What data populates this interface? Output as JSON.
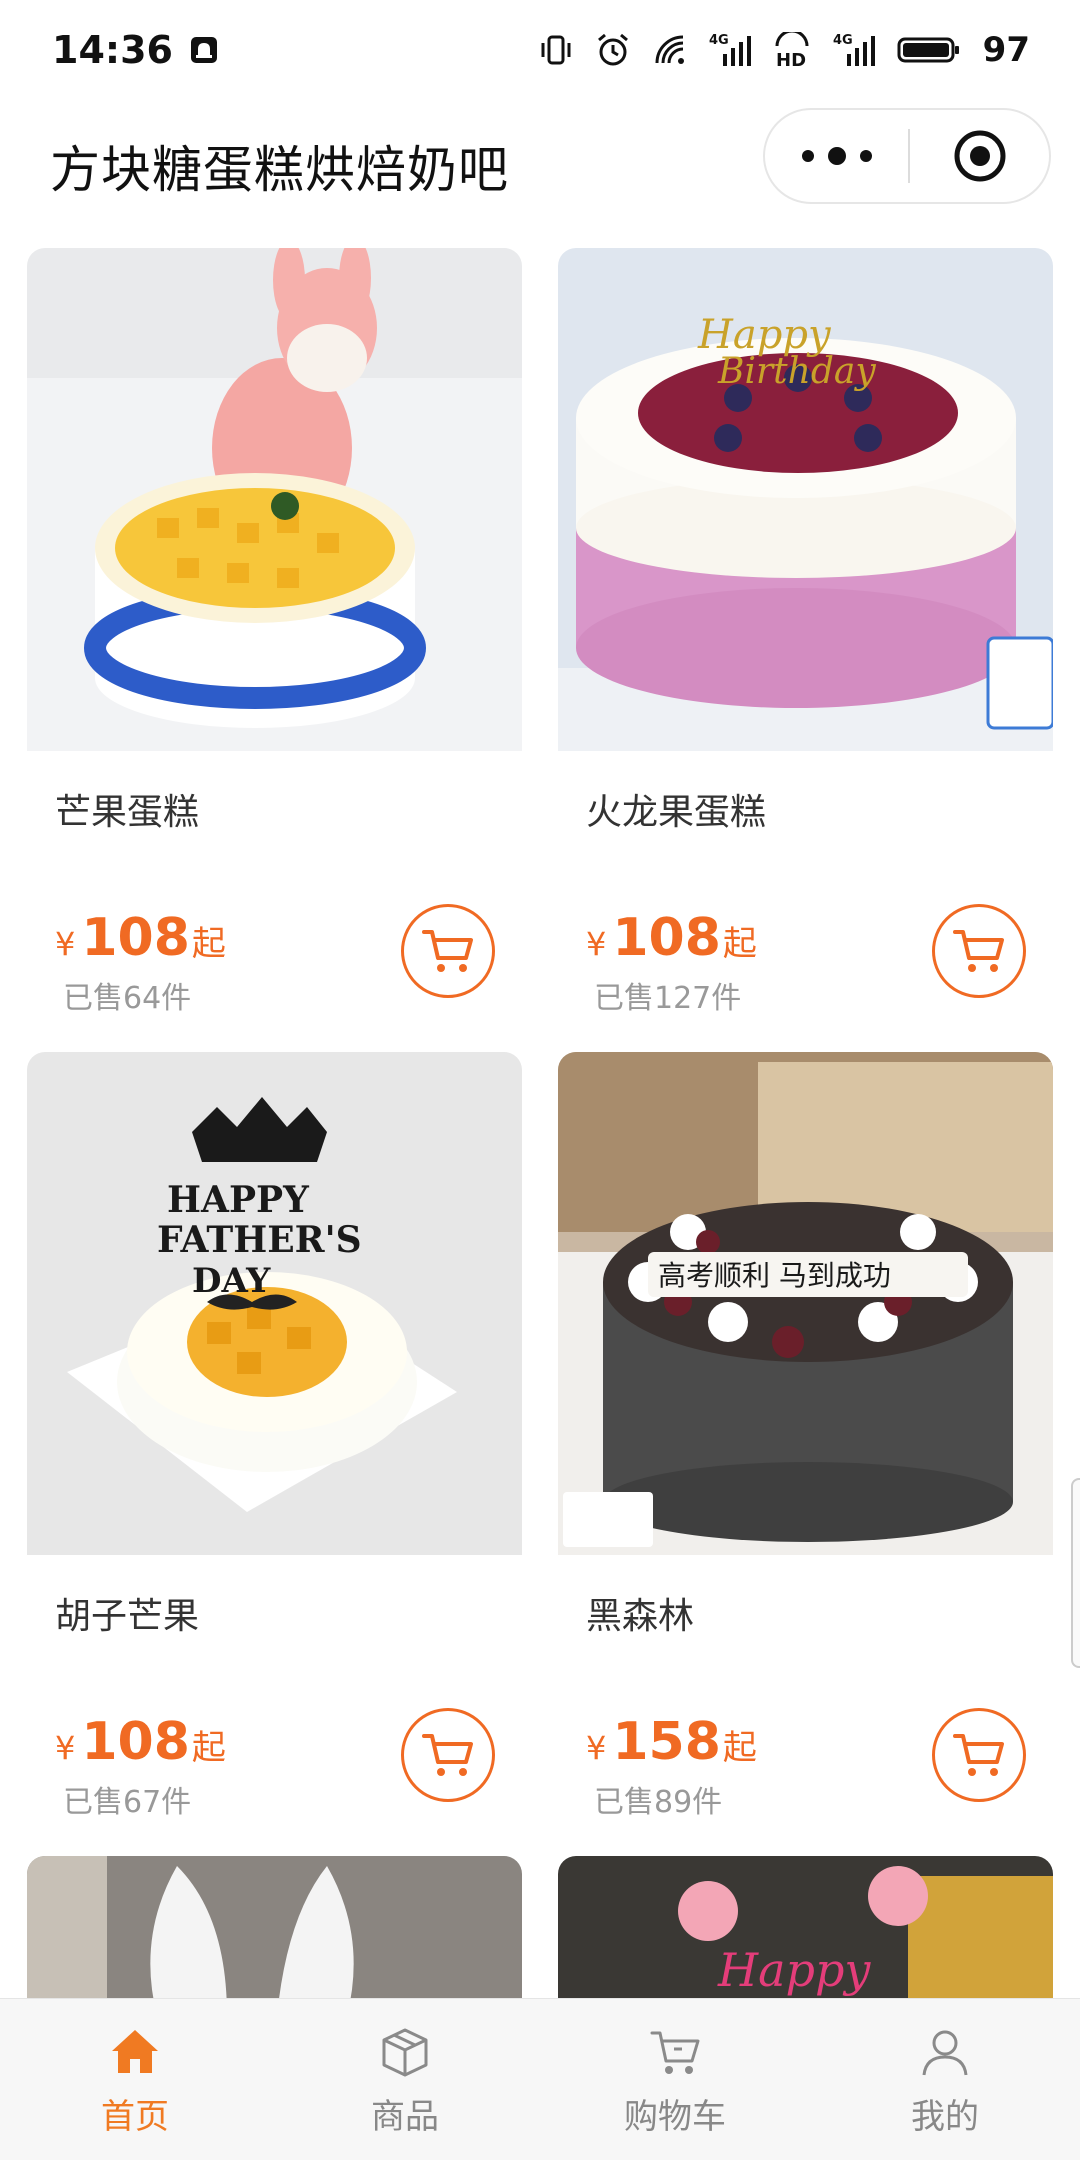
{
  "status_bar": {
    "time": "14:36",
    "battery": "97",
    "icons": [
      "notification-icon",
      "vibrate-icon",
      "alarm-icon",
      "wifi-icon",
      "signal-4g-icon",
      "hd-icon",
      "signal-4g-icon",
      "battery-icon"
    ]
  },
  "header": {
    "title": "方块糖蛋糕烘焙奶吧",
    "more_icon": "more-dots-icon",
    "close_icon": "target-close-icon"
  },
  "products": [
    {
      "name": "芒果蛋糕",
      "currency": "¥",
      "price": "108",
      "suffix": "起",
      "sold": "已售64件"
    },
    {
      "name": "火龙果蛋糕",
      "currency": "¥",
      "price": "108",
      "suffix": "起",
      "sold": "已售127件"
    },
    {
      "name": "胡子芒果",
      "currency": "¥",
      "price": "108",
      "suffix": "起",
      "sold": "已售67件"
    },
    {
      "name": "黑森林",
      "currency": "¥",
      "price": "158",
      "suffix": "起",
      "sold": "已售89件"
    }
  ],
  "partial_images": {
    "left_text": "",
    "right_text": "Happy"
  },
  "tabbar": {
    "tabs": [
      {
        "label": "首页",
        "icon": "home-icon",
        "active": true
      },
      {
        "label": "商品",
        "icon": "box-icon",
        "active": false
      },
      {
        "label": "购物车",
        "icon": "cart-icon",
        "active": false
      },
      {
        "label": "我的",
        "icon": "user-icon",
        "active": false
      }
    ]
  },
  "colors": {
    "accent": "#f06a23",
    "tab_active": "#f07a22",
    "muted": "#999999"
  }
}
